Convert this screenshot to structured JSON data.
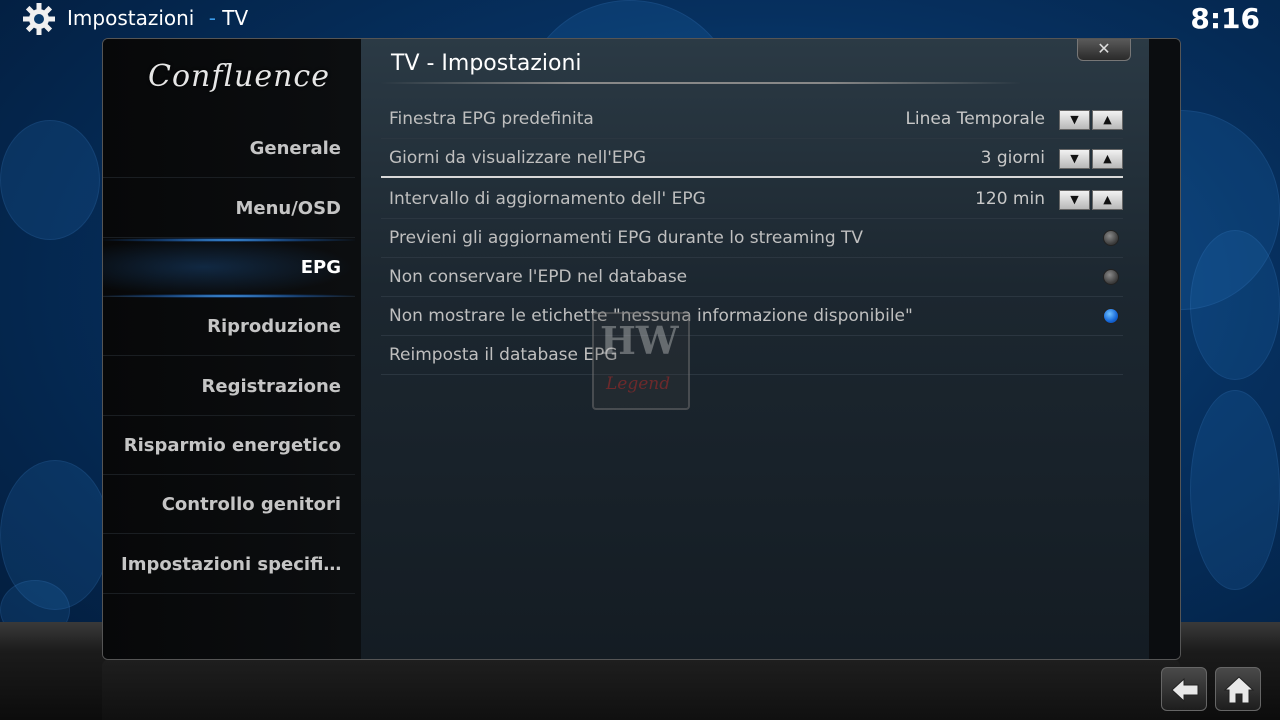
{
  "header": {
    "section": "Impostazioni",
    "separator": "-",
    "subsection": "TV",
    "clock": "8:16"
  },
  "sidebar": {
    "logo": "Confluence",
    "items": [
      {
        "label": "Generale"
      },
      {
        "label": "Menu/OSD"
      },
      {
        "label": "EPG"
      },
      {
        "label": "Riproduzione"
      },
      {
        "label": "Registrazione"
      },
      {
        "label": "Risparmio energetico"
      },
      {
        "label": "Controllo genitori"
      },
      {
        "label": "Impostazioni specifi…"
      }
    ],
    "selected": "EPG"
  },
  "dialog": {
    "title": "TV - Impostazioni",
    "close_label": "✕"
  },
  "settings": [
    {
      "label": "Finestra EPG predefinita",
      "value": "Linea Temporale",
      "control": "spinner"
    },
    {
      "label": "Giorni da visualizzare nell'EPG",
      "value": "3 giorni",
      "control": "spinner"
    },
    {
      "label": "Intervallo di aggiornamento dell' EPG",
      "value": "120 min",
      "control": "spinner"
    },
    {
      "label": "Previeni gli aggiornamenti EPG durante lo streaming TV",
      "control": "radio",
      "checked": false
    },
    {
      "label": "Non conservare l'EPD nel database",
      "control": "radio",
      "checked": false
    },
    {
      "label": "Non mostrare le etichette \"nessuna informazione disponibile\"",
      "control": "radio",
      "checked": true
    },
    {
      "label": "Reimposta il database EPG",
      "control": "button"
    }
  ],
  "spinner": {
    "down": "▼",
    "up": "▲"
  },
  "watermark": {
    "top": "HW",
    "bottom": "Legend"
  },
  "icons": {
    "settings": "gear-icon",
    "back": "back-arrow-icon",
    "home": "home-icon"
  },
  "colors": {
    "accent": "#3b9ae8",
    "radio_on": "#1566d6"
  }
}
